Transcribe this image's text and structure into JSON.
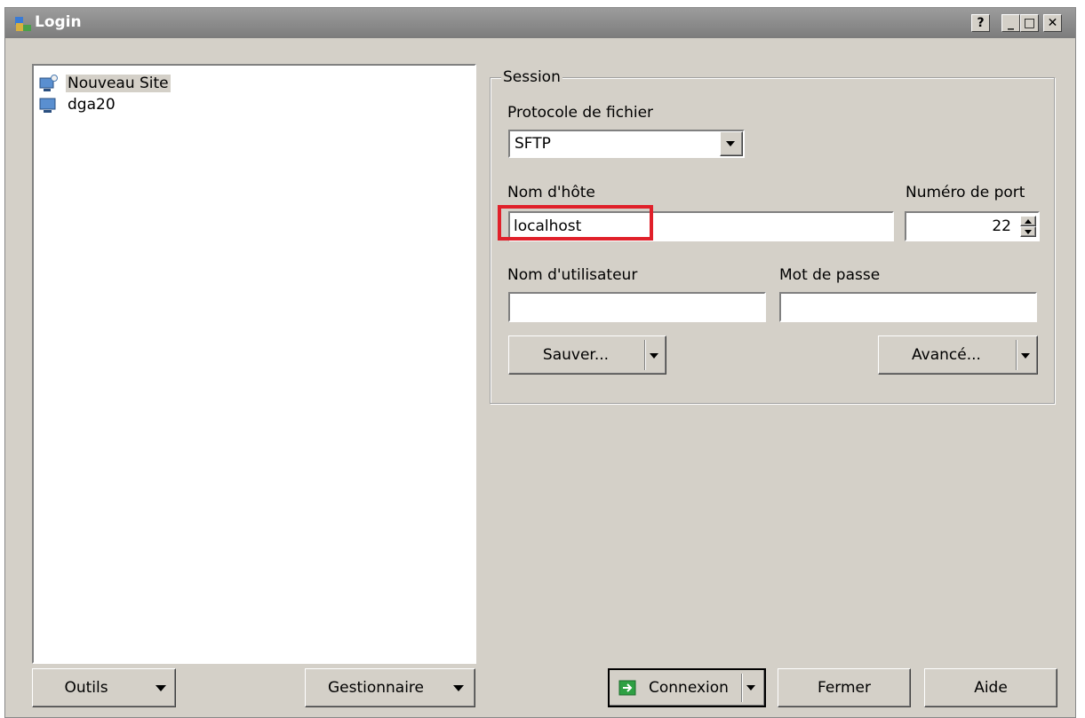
{
  "window": {
    "title": "Login"
  },
  "title_buttons": {
    "help": "?",
    "minimize": "_",
    "maximize": "□",
    "close": "✕"
  },
  "sites": [
    {
      "label": "Nouveau Site",
      "icon": "new-site-computer-icon"
    },
    {
      "label": "dga20",
      "icon": "computer-icon"
    }
  ],
  "left_buttons": {
    "tools": "Outils",
    "manager": "Gestionnaire"
  },
  "session": {
    "legend": "Session",
    "protocol_label": "Protocole de fichier",
    "protocol_value": "SFTP",
    "host_label": "Nom d'hôte",
    "host_value": "localhost",
    "port_label": "Numéro de port",
    "port_value": "22",
    "user_label": "Nom d'utilisateur",
    "user_value": "",
    "password_label": "Mot de passe",
    "password_value": "",
    "save_button": "Sauver...",
    "advanced_button": "Avancé..."
  },
  "bottom_buttons": {
    "connect": "Connexion",
    "close": "Fermer",
    "help": "Aide"
  },
  "colors": {
    "highlight_box": "#e0202a",
    "window_bg": "#d4d0c8",
    "titlebar": "#8c8c8c"
  }
}
